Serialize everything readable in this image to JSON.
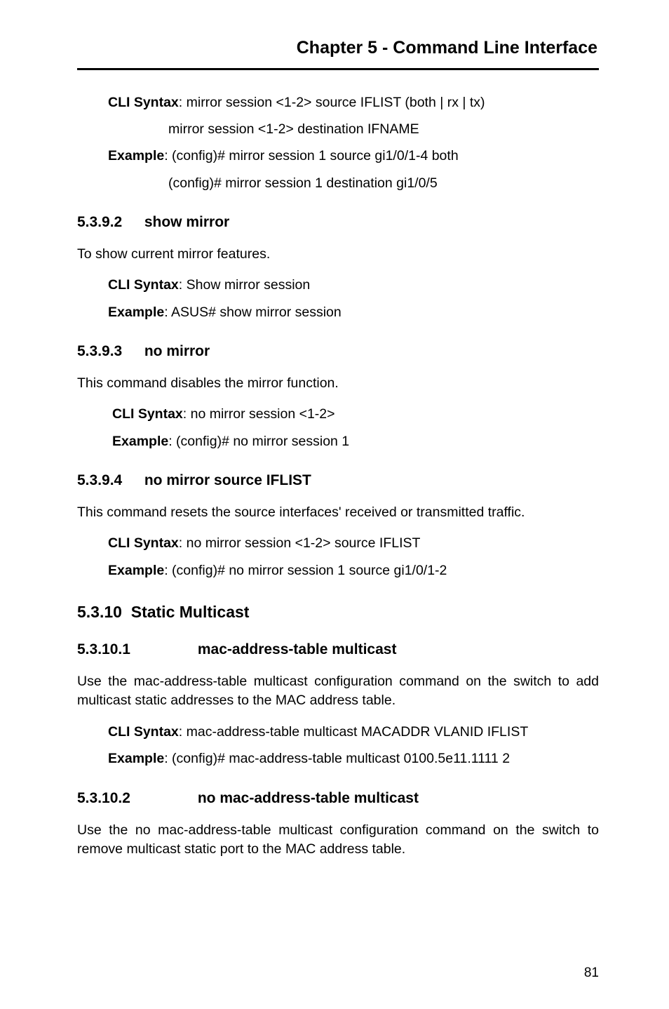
{
  "chapter_title": "Chapter 5 - Command Line Interface",
  "intro": {
    "cli_syntax_label": "CLI Syntax",
    "cli_syntax_line1": ": mirror session <1-2> source IFLIST (both | rx | tx)",
    "cli_syntax_line2": "mirror session <1-2> destination IFNAME",
    "example_label": "Example",
    "example_line1": ":  (config)# mirror session 1  source gi1/0/1-4 both",
    "example_line2": "(config)# mirror session 1 destination gi1/0/5"
  },
  "s5392": {
    "heading_num": "5.3.9.2",
    "heading_text": "show mirror",
    "desc": "To show current mirror features.",
    "cli_syntax_label": "CLI Syntax",
    "cli_syntax": ": Show mirror session",
    "example_label": "Example",
    "example": ":  ASUS# show mirror session"
  },
  "s5393": {
    "heading_num": "5.3.9.3",
    "heading_text": "no mirror",
    "desc": "This command disables the mirror function.",
    "cli_syntax_label": "CLI Syntax",
    "cli_syntax": ": no mirror session <1-2>",
    "example_label": "Example",
    "example": ": (config)# no mirror session 1"
  },
  "s5394": {
    "heading_num": "5.3.9.4",
    "heading_text": "no mirror source IFLIST",
    "desc": "This command resets the source interfaces' received or transmitted traffic.",
    "cli_syntax_label": "CLI Syntax",
    "cli_syntax": ": no mirror session <1-2> source IFLIST",
    "example_label": "Example",
    "example": ":  (config)# no mirror session 1 source gi1/0/1-2"
  },
  "s5310": {
    "heading_num": "5.3.10",
    "heading_text": "Static Multicast"
  },
  "s53101": {
    "heading_num": "5.3.10.1",
    "heading_text": "mac-address-table multicast",
    "desc": "Use the mac-address-table multicast configuration command on the switch to add multicast static addresses to the MAC address table.",
    "cli_syntax_label": "CLI Syntax",
    "cli_syntax": ": mac-address-table multicast MACADDR VLANID IFLIST",
    "example_label": "Example",
    "example": ":  (config)# mac-address-table multicast 0100.5e11.1111 2"
  },
  "s53102": {
    "heading_num": "5.3.10.2",
    "heading_text": "no mac-address-table multicast",
    "desc": "Use the no mac-address-table multicast configuration command on the switch to remove multicast static port to the MAC address table."
  },
  "page_number": "81"
}
